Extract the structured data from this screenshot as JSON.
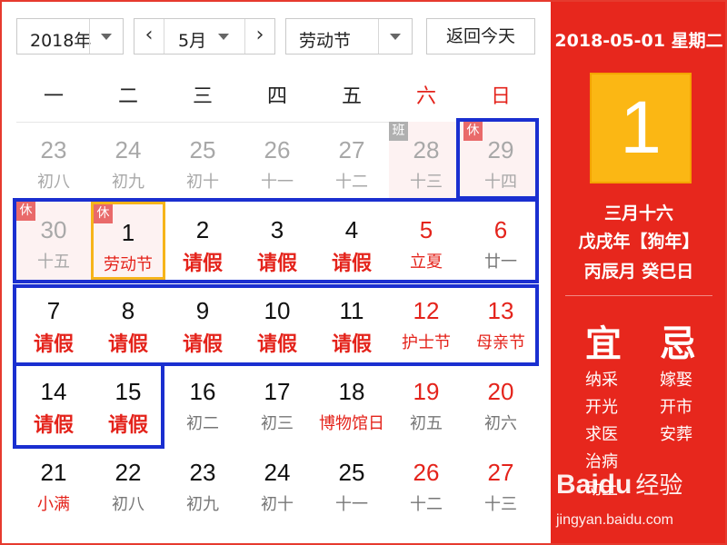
{
  "toolbar": {
    "year": "2018年",
    "prev": "‹",
    "month": "5月",
    "next": "›",
    "holiday": "劳动节",
    "today": "返回今天"
  },
  "weekdays": [
    "一",
    "二",
    "三",
    "四",
    "五",
    "六",
    "日"
  ],
  "weeks": [
    [
      {
        "num": "23",
        "sub": "初八"
      },
      {
        "num": "24",
        "sub": "初九"
      },
      {
        "num": "25",
        "sub": "初十"
      },
      {
        "num": "26",
        "sub": "十一"
      },
      {
        "num": "27",
        "sub": "十二"
      },
      {
        "num": "28",
        "sub": "十三",
        "badge": "班"
      },
      {
        "num": "29",
        "sub": "十四",
        "badge": "休"
      }
    ],
    [
      {
        "num": "30",
        "sub": "十五",
        "badge": "休"
      },
      {
        "num": "1",
        "sub": "劳动节",
        "badge": "休"
      },
      {
        "num": "2",
        "sub": "请假"
      },
      {
        "num": "3",
        "sub": "请假"
      },
      {
        "num": "4",
        "sub": "请假"
      },
      {
        "num": "5",
        "sub": "立夏"
      },
      {
        "num": "6",
        "sub": "廿一"
      }
    ],
    [
      {
        "num": "7",
        "sub": "请假"
      },
      {
        "num": "8",
        "sub": "请假"
      },
      {
        "num": "9",
        "sub": "请假"
      },
      {
        "num": "10",
        "sub": "请假"
      },
      {
        "num": "11",
        "sub": "请假"
      },
      {
        "num": "12",
        "sub": "护士节"
      },
      {
        "num": "13",
        "sub": "母亲节"
      }
    ],
    [
      {
        "num": "14",
        "sub": "请假"
      },
      {
        "num": "15",
        "sub": "请假"
      },
      {
        "num": "16",
        "sub": "初二"
      },
      {
        "num": "17",
        "sub": "初三"
      },
      {
        "num": "18",
        "sub": "博物馆日"
      },
      {
        "num": "19",
        "sub": "初五"
      },
      {
        "num": "20",
        "sub": "初六"
      }
    ],
    [
      {
        "num": "21",
        "sub": "小满"
      },
      {
        "num": "22",
        "sub": "初八"
      },
      {
        "num": "23",
        "sub": "初九"
      },
      {
        "num": "24",
        "sub": "初十"
      },
      {
        "num": "25",
        "sub": "十一"
      },
      {
        "num": "26",
        "sub": "十二"
      },
      {
        "num": "27",
        "sub": "十三"
      }
    ]
  ],
  "side": {
    "date": "2018-05-01 星期二",
    "day": "1",
    "lunar1": "三月十六",
    "lunar2": "戊戌年【狗年】",
    "lunar3": "丙辰月 癸巳日",
    "yi_title": "宜",
    "ji_title": "忌",
    "yi": [
      "纳采",
      "开光",
      "求医",
      "治病",
      "动土"
    ],
    "ji": [
      "嫁娶",
      "开市",
      "安葬"
    ]
  },
  "watermark": {
    "logo": "Baidu",
    "logo2": "经验",
    "url": "jingyan.baidu.com"
  },
  "colors": {
    "accent": "#e7271d",
    "today_box": "#fbb714",
    "highlight": "#1a2fd0",
    "rest_badge": "#e96a6a",
    "work_badge": "#b0b0b0"
  }
}
